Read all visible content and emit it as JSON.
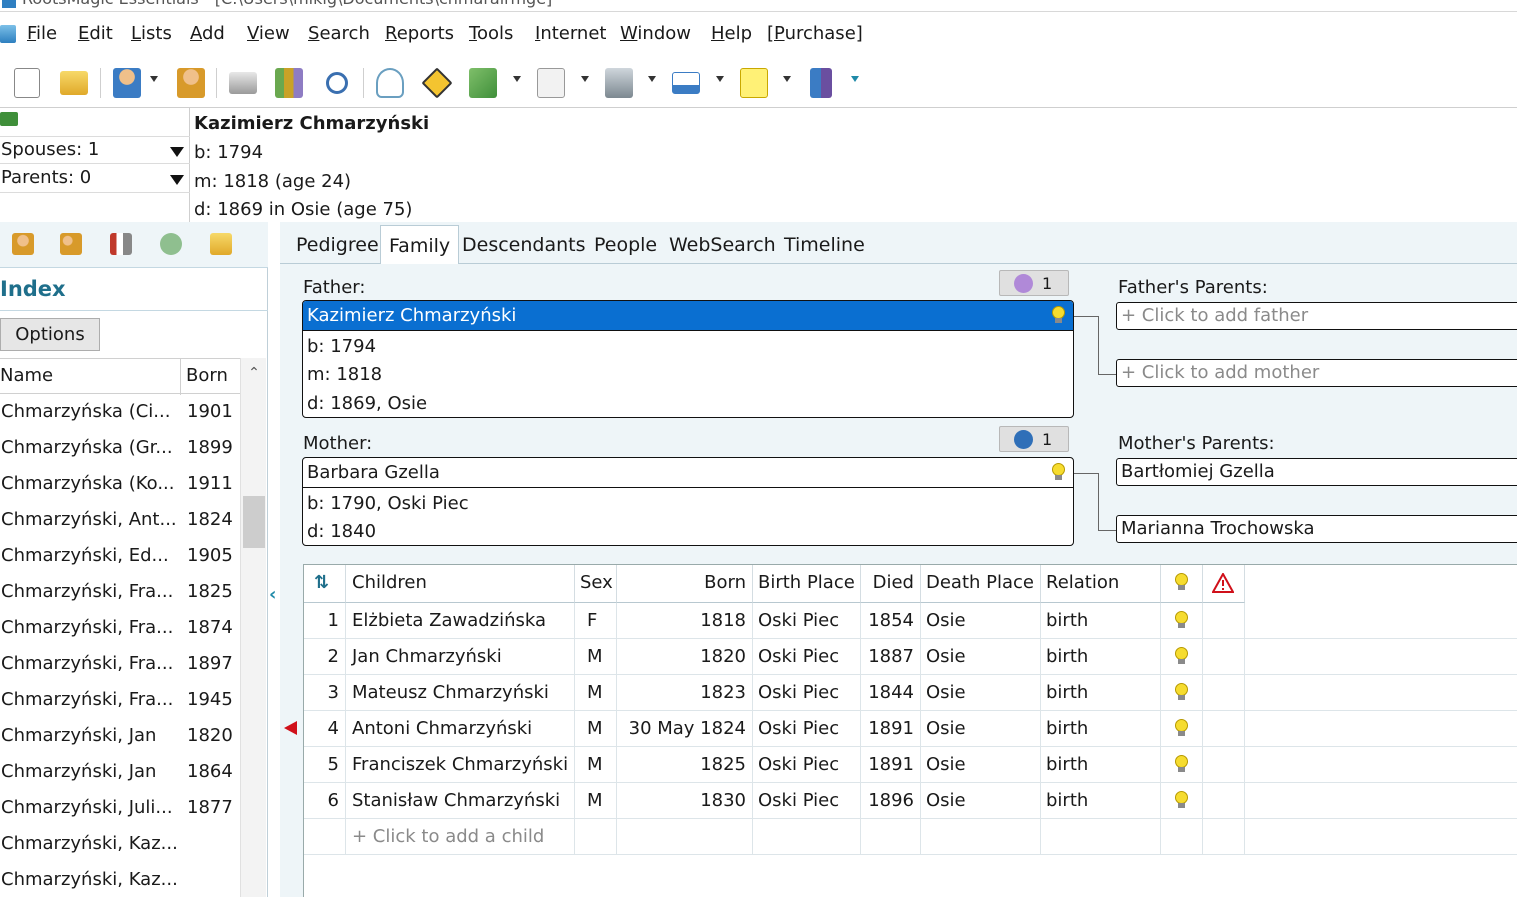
{
  "window": {
    "title": "RootsMagic Essentials - [C:\\Users\\mikig\\Documents\\chmarairmge]"
  },
  "menu": [
    "File",
    "Edit",
    "Lists",
    "Add",
    "View",
    "Search",
    "Reports",
    "Tools",
    "Internet",
    "Window",
    "Help",
    "[Purchase]"
  ],
  "toolbar": {
    "icons": [
      "new-file-icon",
      "open-folder-icon",
      "add-person-icon",
      "edit-person-icon",
      "print-icon",
      "books-icon",
      "search-icon",
      "tree-icon",
      "navigate-icon",
      "sources-icon",
      "certificate-icon",
      "media-icon",
      "display-icon",
      "note-icon",
      "exit-icon"
    ]
  },
  "header": {
    "spouses": "Spouses: 1",
    "parents": "Parents: 0",
    "person_name": "Kazimierz Chmarzyński",
    "birth": "b: 1794",
    "marriage": "m: 1818 (age 24)",
    "death": "d: 1869 in Osie (age 75)"
  },
  "sidebar": {
    "title": "Index",
    "options_label": "Options",
    "columns": [
      "Name",
      "Born"
    ],
    "rows": [
      {
        "name": "Chmarzyńska (Ci...",
        "born": "1901"
      },
      {
        "name": "Chmarzyńska (Gr...",
        "born": "1899"
      },
      {
        "name": "Chmarzyńska (Ko...",
        "born": "1911"
      },
      {
        "name": "Chmarzyński, Ant...",
        "born": "1824"
      },
      {
        "name": "Chmarzyński, Ed...",
        "born": "1905"
      },
      {
        "name": "Chmarzyński, Fra...",
        "born": "1825"
      },
      {
        "name": "Chmarzyński, Fra...",
        "born": "1874"
      },
      {
        "name": "Chmarzyński, Fra...",
        "born": "1897"
      },
      {
        "name": "Chmarzyński, Fra...",
        "born": "1945"
      },
      {
        "name": "Chmarzyński, Jan",
        "born": "1820"
      },
      {
        "name": "Chmarzyński, Jan",
        "born": "1864"
      },
      {
        "name": "Chmarzyński, Juli...",
        "born": "1877"
      },
      {
        "name": "Chmarzyński, Kaz...",
        "born": ""
      },
      {
        "name": "Chmarzyński, Kaz...",
        "born": ""
      }
    ]
  },
  "tabs": [
    "Pedigree",
    "Family",
    "Descendants",
    "People",
    "WebSearch",
    "Timeline"
  ],
  "active_tab": "Family",
  "family": {
    "father_label": "Father:",
    "father_count": "1",
    "father": {
      "name": "Kazimierz Chmarzyński",
      "b": "b: 1794",
      "m": "m: 1818",
      "d": "d: 1869, Osie"
    },
    "mother_label": "Mother:",
    "mother_count": "1",
    "mother": {
      "name": "Barbara Gzella",
      "b": "b: 1790, Oski Piec",
      "d": "d: 1840"
    },
    "fathers_parents_label": "Father's Parents:",
    "add_father": "+ Click to add father",
    "add_mother": "+ Click to add mother",
    "mothers_parents_label": "Mother's Parents:",
    "mothers_father": "Bartłomiej Gzella",
    "mothers_mother": "Marianna Trochowska"
  },
  "children": {
    "columns": [
      "Children",
      "Sex",
      "Born",
      "Birth Place",
      "Died",
      "Death Place",
      "Relation"
    ],
    "rows": [
      {
        "num": "1",
        "name": "Elżbieta Zawadzińska",
        "sex": "F",
        "born": "1818",
        "birth_place": "Oski Piec",
        "died": "1854",
        "death_place": "Osie",
        "relation": "birth"
      },
      {
        "num": "2",
        "name": "Jan Chmarzyński",
        "sex": "M",
        "born": "1820",
        "birth_place": "Oski Piec",
        "died": "1887",
        "death_place": "Osie",
        "relation": "birth"
      },
      {
        "num": "3",
        "name": "Mateusz Chmarzyński",
        "sex": "M",
        "born": "1823",
        "birth_place": "Oski Piec",
        "died": "1844",
        "death_place": "Osie",
        "relation": "birth"
      },
      {
        "num": "4",
        "name": "Antoni Chmarzyński",
        "sex": "M",
        "born": "30 May 1824",
        "birth_place": "Oski Piec",
        "died": "1891",
        "death_place": "Osie",
        "relation": "birth"
      },
      {
        "num": "5",
        "name": "Franciszek Chmarzyński",
        "sex": "M",
        "born": "1825",
        "birth_place": "Oski Piec",
        "died": "1891",
        "death_place": "Osie",
        "relation": "birth"
      },
      {
        "num": "6",
        "name": "Stanisław Chmarzyński",
        "sex": "M",
        "born": "1830",
        "birth_place": "Oski Piec",
        "died": "1896",
        "death_place": "Osie",
        "relation": "birth"
      }
    ],
    "add_child": "+ Click to add a child"
  },
  "colors": {
    "selection": "#0a6fd1",
    "panel_bg": "#eef5f8",
    "accent": "#1f6f8b",
    "marker": "#d0101a",
    "hint": "#f6dc2f"
  }
}
